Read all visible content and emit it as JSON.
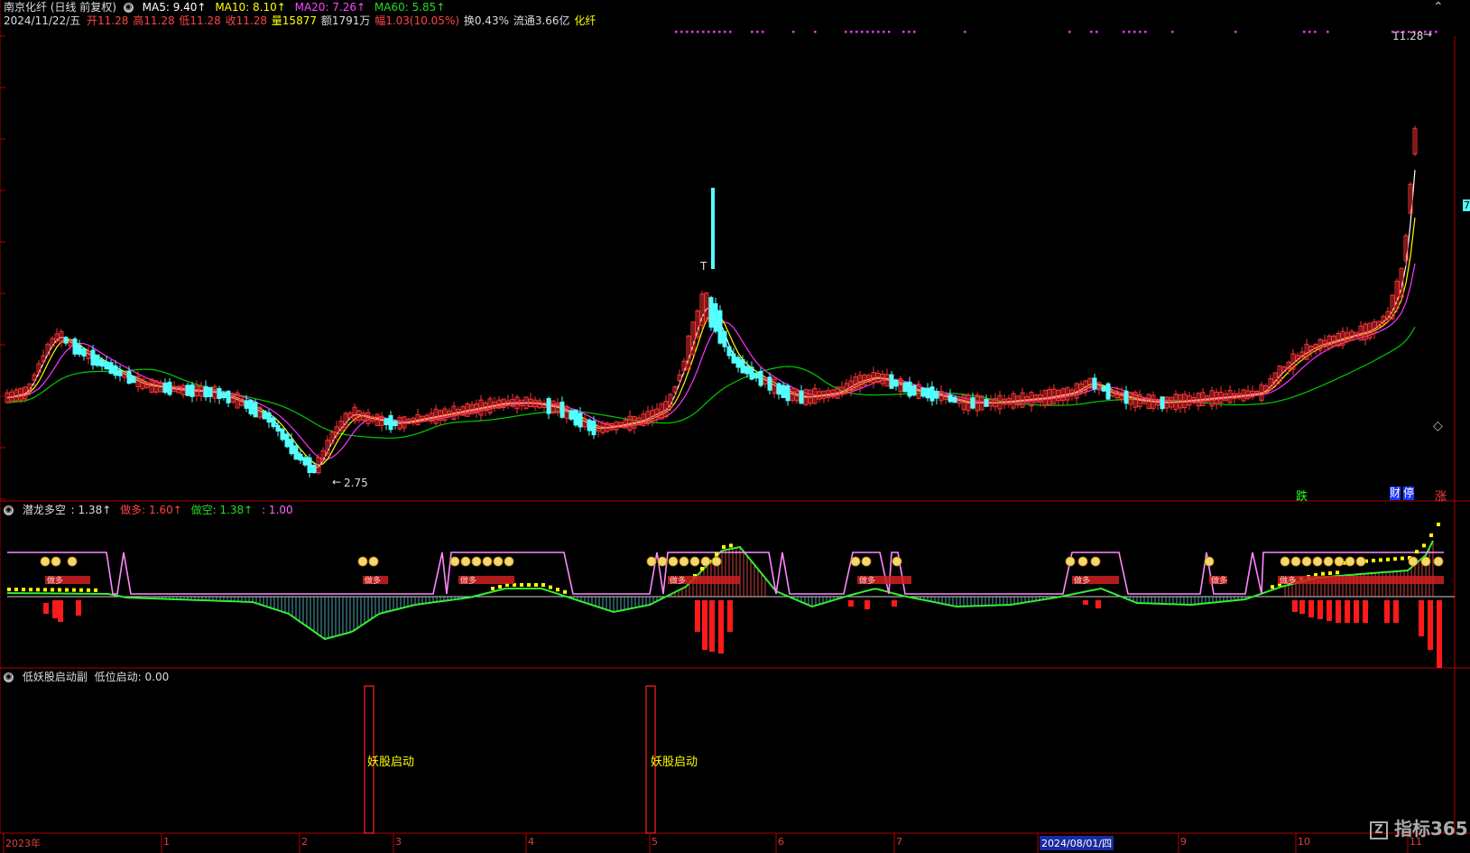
{
  "header": {
    "title": "南京化纤 (日线 前复权)",
    "ma5": "MA5: 9.40↑",
    "ma10": "MA10: 8.10↑",
    "ma20": "MA20: 7.26↑",
    "ma60": "MA60: 5.85↑",
    "date": "2024/11/22/五",
    "open": "开11.28",
    "high": "高11.28",
    "low": "低11.28",
    "close": "收11.28",
    "volume": "量15877",
    "amount": "额1791万",
    "change": "幅1.03(10.05%)",
    "turnover": "换0.43%",
    "float": "流通3.66亿",
    "sector": "化纤"
  },
  "price_panel": {
    "high_label": "11.28",
    "low_label": "2.75",
    "t_label": "T",
    "badge_fall": "跌",
    "badge_report": "财",
    "badge_stop": "停",
    "badge_rise": "涨",
    "right_edge_label": "7"
  },
  "indicator1": {
    "name": "潜龙多空",
    "v1": ": 1.38↑",
    "long_label": "做多: 1.60↑",
    "short_label": "做空: 1.38↑",
    "v4": ": 1.00",
    "zone_text": "做多",
    "coin_text": "$"
  },
  "indicator2": {
    "name": "低妖股启动副",
    "value_label": "低位启动: 0.00",
    "signal_text": "妖股启动"
  },
  "xaxis": {
    "labels": [
      "2023年",
      "1",
      "2",
      "3",
      "4",
      "5",
      "6",
      "7",
      "2024/08/01/四",
      "9",
      "10",
      "11"
    ]
  },
  "brand": "指标365",
  "colors": {
    "up": "#ff3333",
    "down": "#54ffff",
    "ma5": "#ffffff",
    "ma10": "#ffff00",
    "ma20": "#ff33ff",
    "ma60": "#00cc00",
    "grid": "#8b0000"
  },
  "chart_data": {
    "type": "candlestick",
    "title": "南京化纤 (日线 前复权)",
    "ylabel": "",
    "xlabel": "",
    "high": 11.28,
    "low": 2.75,
    "last_close": 11.28,
    "ma": {
      "MA5": 9.4,
      "MA10": 8.1,
      "MA20": 7.26,
      "MA60": 5.85
    }
  }
}
